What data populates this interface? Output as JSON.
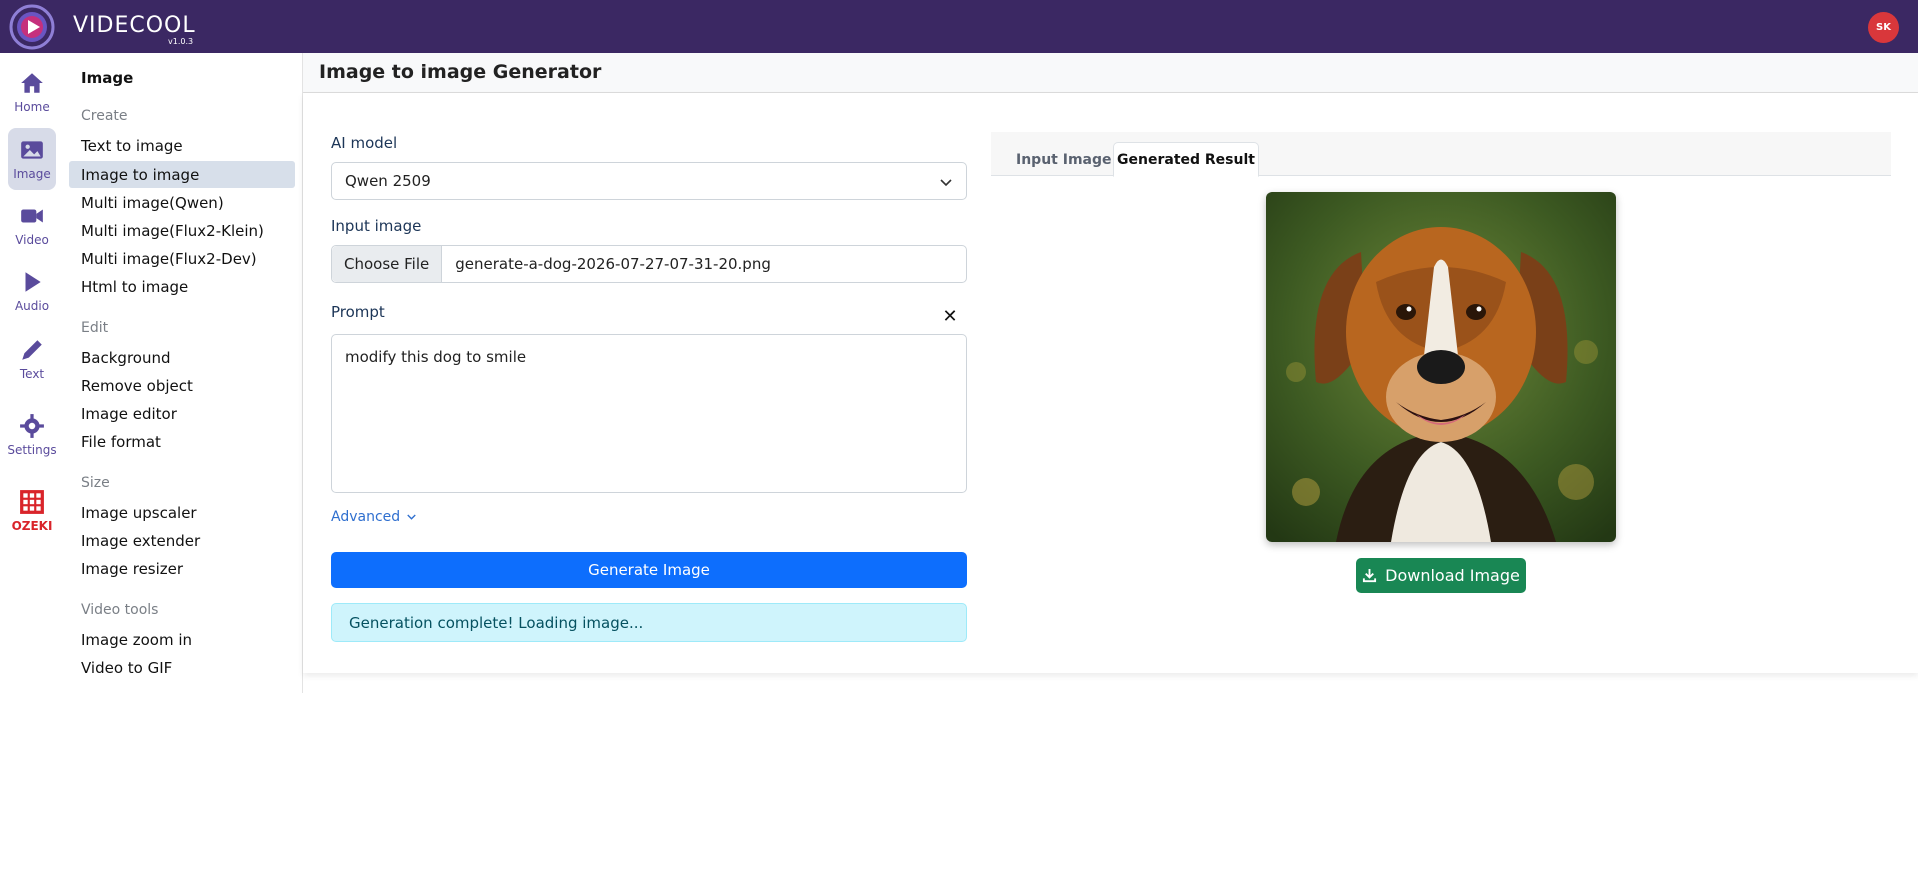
{
  "app": {
    "brand": "VIDECOOL",
    "version": "v1.0.3",
    "user_initials": "SK"
  },
  "rail": [
    {
      "label": "Home",
      "icon": "home-icon"
    },
    {
      "label": "Image",
      "icon": "image-icon",
      "active": true
    },
    {
      "label": "Video",
      "icon": "video-icon"
    },
    {
      "label": "Audio",
      "icon": "play-icon"
    },
    {
      "label": "Text",
      "icon": "pencil-icon"
    },
    {
      "label": "Settings",
      "icon": "gear-icon"
    },
    {
      "label": "OZEKI",
      "icon": "ozeki-logo-icon"
    }
  ],
  "submenu": {
    "title": "Image",
    "sections": [
      {
        "heading": "Create",
        "items": [
          "Text to image",
          "Image to image",
          "Multi image(Qwen)",
          "Multi image(Flux2-Klein)",
          "Multi image(Flux2-Dev)",
          "Html to image"
        ]
      },
      {
        "heading": "Edit",
        "items": [
          "Background",
          "Remove object",
          "Image editor",
          "File format"
        ]
      },
      {
        "heading": "Size",
        "items": [
          "Image upscaler",
          "Image extender",
          "Image resizer"
        ]
      },
      {
        "heading": "Video tools",
        "items": [
          "Image zoom in",
          "Video to GIF"
        ]
      }
    ],
    "active_item": "Image to image"
  },
  "main": {
    "title": "Image to image Generator",
    "form": {
      "model_label": "AI model",
      "model_value": "Qwen 2509",
      "input_label": "Input image",
      "choose_file": "Choose File",
      "file_name": "generate-a-dog-2026-07-27-07-31-20.png",
      "prompt_label": "Prompt",
      "prompt_value": "modify this dog to smile",
      "clear_symbol": "✕",
      "advanced": "Advanced",
      "generate": "Generate Image",
      "status": "Generation complete! Loading image..."
    },
    "tabs": [
      {
        "label": "Input Image",
        "active": false
      },
      {
        "label": "Generated Result",
        "active": true
      }
    ],
    "download": "Download Image"
  },
  "colors": {
    "topbar": "#3b2863",
    "primary": "#0d6efd",
    "success": "#198754",
    "info_bg": "#cff4fc",
    "avatar": "#d9373b"
  }
}
